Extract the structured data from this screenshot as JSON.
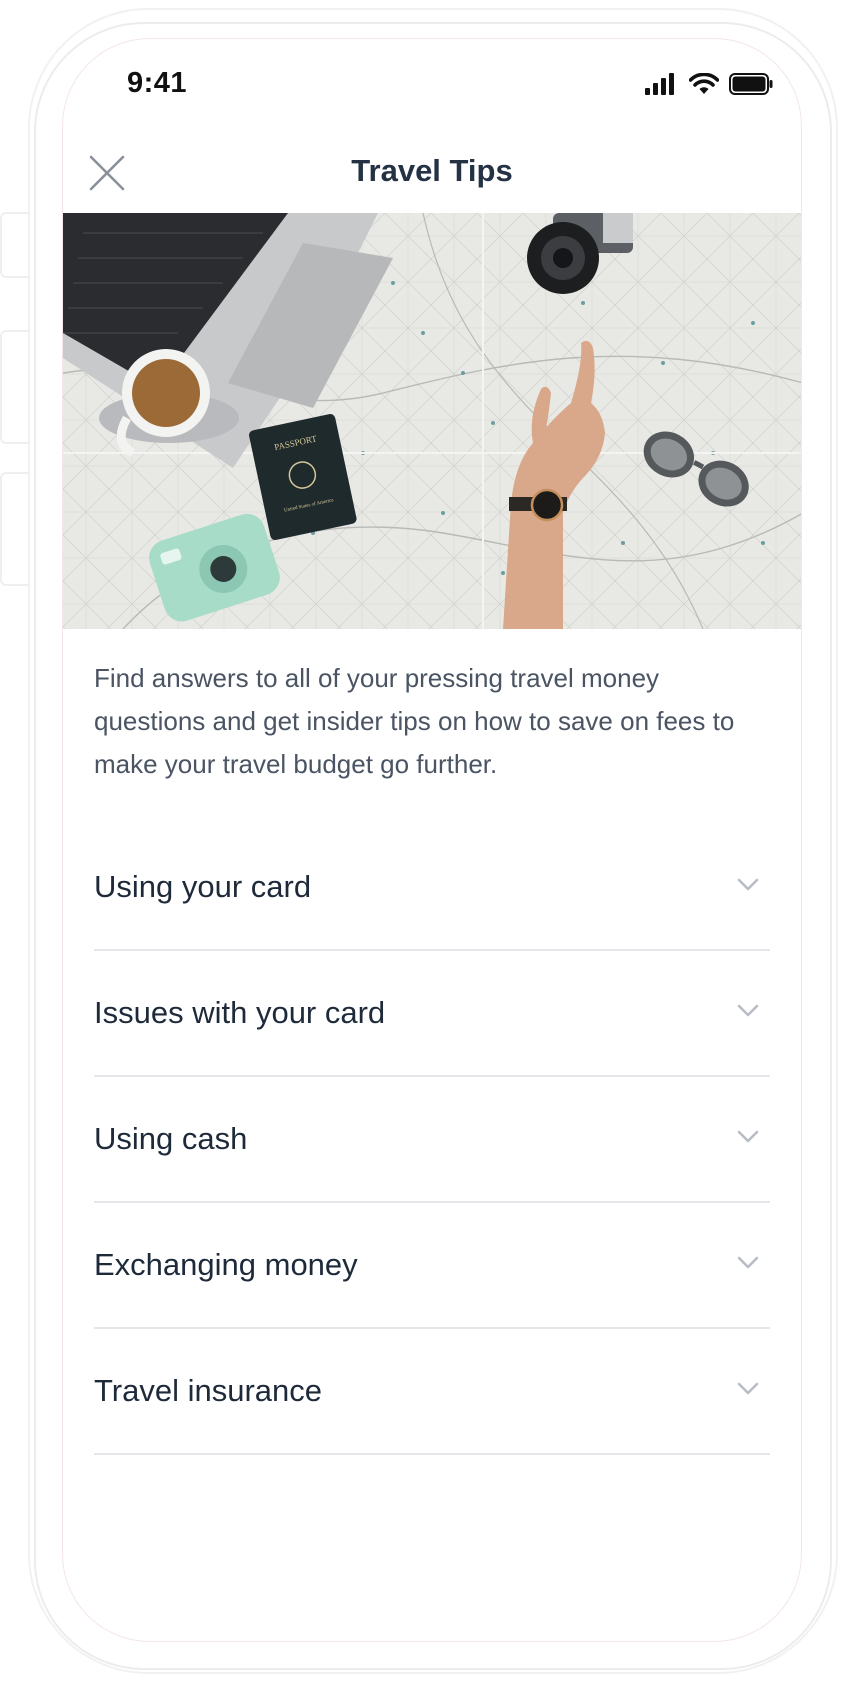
{
  "status_bar": {
    "time": "9:41",
    "icons": [
      "cellular-signal-icon",
      "wifi-icon",
      "battery-icon"
    ]
  },
  "nav": {
    "close_icon": "close-icon",
    "title": "Travel Tips"
  },
  "hero": {
    "passport_text": "PASSPORT",
    "passport_subtext": "United States of America"
  },
  "intro_text": "Find answers to all of your pressing travel money questions and get insider tips on how to save on fees to make your travel budget go further.",
  "faq": [
    {
      "label": "Using your card",
      "icon": "chevron-down-icon"
    },
    {
      "label": "Issues with your card",
      "icon": "chevron-down-icon"
    },
    {
      "label": "Using cash",
      "icon": "chevron-down-icon"
    },
    {
      "label": "Exchanging money",
      "icon": "chevron-down-icon"
    },
    {
      "label": "Travel insurance",
      "icon": "chevron-down-icon"
    }
  ],
  "colors": {
    "title": "#243244",
    "body_text": "#4a5463",
    "item_text": "#1e2a3a",
    "divider": "#e4e6ea",
    "chevron": "#b9bec6"
  }
}
